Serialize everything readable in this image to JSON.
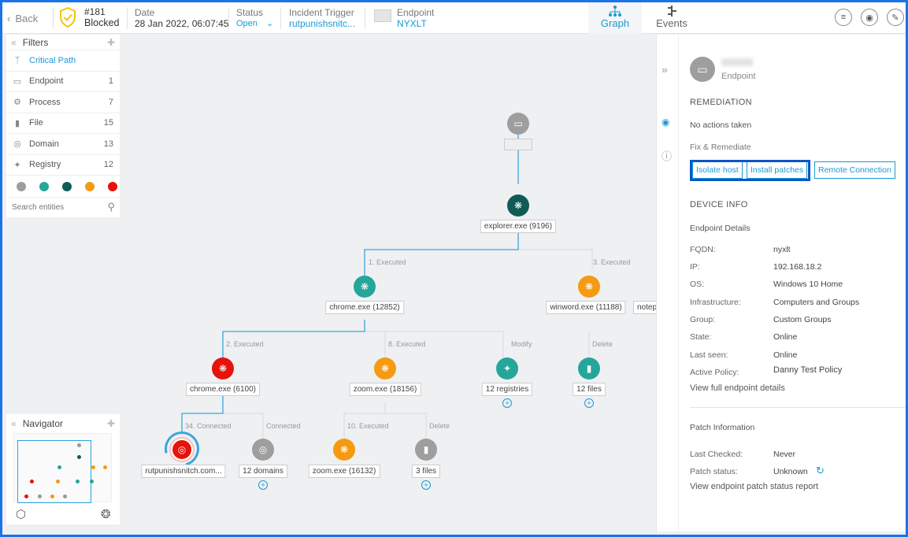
{
  "topbar": {
    "back_label": "Back",
    "incident_number": "#181",
    "incident_status": "Blocked",
    "date_label": "Date",
    "date_value": "28 Jan 2022, 06:07:45",
    "status_label": "Status",
    "status_value": "Open",
    "trigger_label": "Incident Trigger",
    "trigger_value": "rutpunishsnitc...",
    "endpoint_label": "Endpoint",
    "endpoint_value": "NYXLT",
    "tab_graph": "Graph",
    "tab_events": "Events"
  },
  "filters": {
    "title": "Filters",
    "items": [
      {
        "label": "Critical Path",
        "count": ""
      },
      {
        "label": "Endpoint",
        "count": "1"
      },
      {
        "label": "Process",
        "count": "7"
      },
      {
        "label": "File",
        "count": "15"
      },
      {
        "label": "Domain",
        "count": "13"
      },
      {
        "label": "Registry",
        "count": "12"
      }
    ],
    "colors": [
      "#9e9e9e",
      "#26a69a",
      "#0f5c56",
      "#f59a12",
      "#e8120c"
    ],
    "search_placeholder": "Search entities"
  },
  "navigator": {
    "title": "Navigator"
  },
  "graph": {
    "nodes": {
      "explorer": "explorer.exe (9196)",
      "chrome1": "chrome.exe (12852)",
      "winword": "winword.exe (11188)",
      "notep": "notep",
      "chrome2": "chrome.exe (6100)",
      "zoom1": "zoom.exe (18156)",
      "registries": "12 registries",
      "files12": "12 files",
      "domainnode": "rutpunishsnitch.com...",
      "domains": "12 domains",
      "zoom2": "zoom.exe (16132)",
      "files3": "3 files"
    },
    "edges": {
      "e1": "1. Executed",
      "e3": "3. Executed",
      "e2": "2. Executed",
      "e8": "8. Executed",
      "modify": "Modify",
      "delete1": "Delete",
      "e34": "34. Connected",
      "connected": "Connected",
      "e10": "10. Executed",
      "delete2": "Delete"
    }
  },
  "panel": {
    "entity_type": "Endpoint",
    "remediation_title": "REMEDIATION",
    "no_actions": "No actions taken",
    "fix_label": "Fix & Remediate",
    "btn_isolate": "Isolate host",
    "btn_patches": "Install patches",
    "btn_remote": "Remote Connection",
    "device_info_title": "DEVICE INFO",
    "endpoint_details": "Endpoint Details",
    "details": [
      {
        "key": "FQDN:",
        "value": "nyxlt"
      },
      {
        "key": "IP:",
        "value": "192.168.18.2"
      },
      {
        "key": "OS:",
        "value": "Windows 10 Home"
      },
      {
        "key": "Infrastructure:",
        "value": "Computers and Groups"
      },
      {
        "key": "Group:",
        "value": "Custom Groups"
      },
      {
        "key": "State:",
        "value": "Online"
      },
      {
        "key": "Last seen:",
        "value": "Online"
      },
      {
        "key": "Active Policy:",
        "value": "Danny Test Policy"
      }
    ],
    "view_full": "View full endpoint details",
    "patch_title": "Patch Information",
    "last_checked_key": "Last Checked:",
    "last_checked_val": "Never",
    "patch_status_key": "Patch status:",
    "patch_status_val": "Unknown",
    "patch_report": "View endpoint patch status report"
  }
}
